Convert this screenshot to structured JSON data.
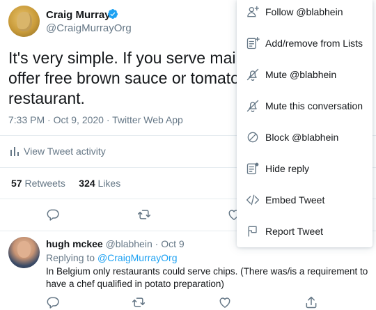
{
  "tweet": {
    "author_name": "Craig Murray",
    "author_handle": "@CraigMurrayOrg",
    "text_lines": [
      "It's very simple. If you serve main co",
      "offer free brown sauce or tomato ke",
      "restaurant."
    ],
    "meta": "7:33 PM · Oct 9, 2020 · Twitter Web App",
    "activity_label": "View Tweet activity",
    "retweets_count": "57",
    "retweets_label": "Retweets",
    "likes_count": "324",
    "likes_label": "Likes"
  },
  "reply": {
    "author_name": "hugh mckee",
    "author_handle": "@blabhein",
    "separator": "·",
    "date": "Oct 9",
    "replying_to_label": "Replying to",
    "replying_to_handle": "@CraigMurrayOrg",
    "text_lines": [
      "In Belgium only restaurants could serve chips. (There was/is a requirement to",
      "have a chef qualified in potato preparation)"
    ]
  },
  "menu": {
    "items": [
      {
        "label": "Follow @blabhein",
        "icon": "follow-icon"
      },
      {
        "label": "Add/remove from Lists",
        "icon": "list-icon"
      },
      {
        "label": "Mute @blabhein",
        "icon": "mute-icon"
      },
      {
        "label": "Mute this conversation",
        "icon": "mute-conversation-icon"
      },
      {
        "label": "Block @blabhein",
        "icon": "block-icon"
      },
      {
        "label": "Hide reply",
        "icon": "hide-reply-icon"
      },
      {
        "label": "Embed Tweet",
        "icon": "embed-icon"
      },
      {
        "label": "Report Tweet",
        "icon": "report-icon"
      }
    ]
  },
  "colors": {
    "text": "#14171a",
    "secondary": "#657786",
    "accent": "#1da1f2",
    "divider": "#e6ecf0"
  }
}
